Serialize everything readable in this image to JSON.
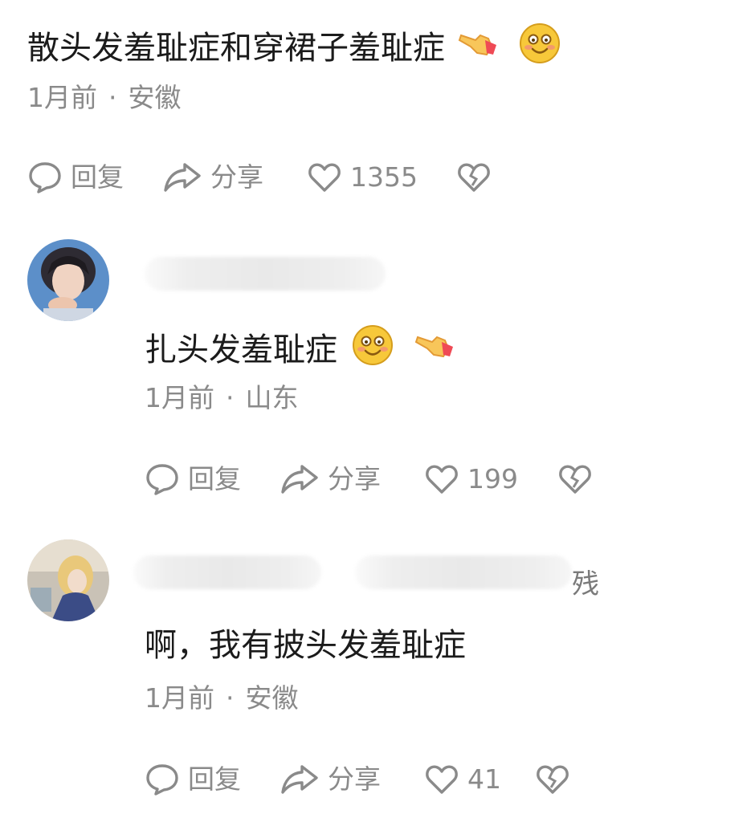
{
  "comments": [
    {
      "text": "散头发羞耻症和穿裙子羞耻症",
      "emojis": [
        "pointing-hand-emoji",
        "smiling-blush-emoji"
      ],
      "time": "1月前",
      "separator": "·",
      "location": "安徽",
      "actions": {
        "reply": "回复",
        "share": "分享",
        "likes": "1355"
      }
    },
    {
      "name_suffix": "",
      "text": "扎头发羞耻症",
      "emojis": [
        "smiling-blush-emoji",
        "pointing-hand-emoji"
      ],
      "time": "1月前",
      "separator": "·",
      "location": "山东",
      "actions": {
        "reply": "回复",
        "share": "分享",
        "likes": "199"
      }
    },
    {
      "name_suffix": "残",
      "text": "啊，我有披头发羞耻症",
      "emojis": [],
      "time": "1月前",
      "separator": "·",
      "location": "安徽",
      "actions": {
        "reply": "回复",
        "share": "分享",
        "likes": "41"
      }
    }
  ],
  "colors": {
    "text": "#1b1b1b",
    "meta": "#8a8a8a",
    "emoji_face": "#f7c83a",
    "emoji_hand": "#f5b04a"
  }
}
